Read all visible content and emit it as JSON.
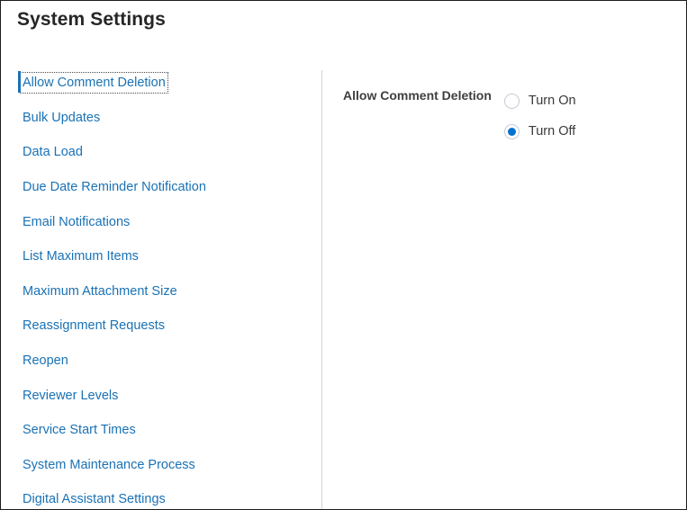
{
  "window": {
    "title": "System Settings",
    "border_color": "#1d1d1d"
  },
  "colors": {
    "link_blue": "#1a72b5",
    "accent_blue": "#0572ce",
    "title_text": "#262626",
    "label_text": "#3f3f3f",
    "divider": "#d4d4d4",
    "radio_border": "#c3ccd6"
  },
  "sidebar": {
    "items": [
      {
        "label": "Allow Comment Deletion",
        "selected": true
      },
      {
        "label": "Bulk Updates",
        "selected": false
      },
      {
        "label": "Data Load",
        "selected": false
      },
      {
        "label": "Due Date Reminder Notification",
        "selected": false
      },
      {
        "label": "Email Notifications",
        "selected": false
      },
      {
        "label": "List Maximum Items",
        "selected": false
      },
      {
        "label": "Maximum Attachment Size",
        "selected": false
      },
      {
        "label": "Reassignment Requests",
        "selected": false
      },
      {
        "label": "Reopen",
        "selected": false
      },
      {
        "label": "Reviewer Levels",
        "selected": false
      },
      {
        "label": "Service Start Times",
        "selected": false
      },
      {
        "label": "System Maintenance Process",
        "selected": false
      },
      {
        "label": "Digital Assistant Settings",
        "selected": false
      }
    ]
  },
  "detail": {
    "setting_label": "Allow Comment Deletion",
    "radio_group_name": "allow-comment-deletion",
    "options": [
      {
        "label": "Turn On",
        "checked": false
      },
      {
        "label": "Turn Off",
        "checked": true
      }
    ],
    "selected_value": "Turn Off"
  }
}
